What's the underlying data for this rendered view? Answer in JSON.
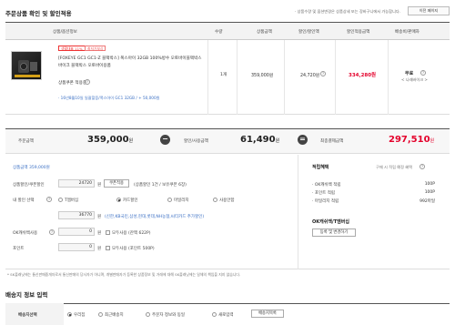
{
  "header": {
    "title": "주문상품 확인 및 할인적용",
    "notice": "· 상품수량 및 옵션변경은 상품상세 또는 장바구니에서 가능합니다.",
    "prev_button": "이전 페이지"
  },
  "table": {
    "columns": [
      "상품/옵션정보",
      "수량",
      "상품금액",
      "할인/할인액",
      "할인적용금액",
      "배송비/판매자"
    ],
    "item": {
      "badges": [
        "생활대표 11%",
        "최저가보상"
      ],
      "name": "[FOXEYE GC1 GC1-Z 블랙박스] 폭스아이 32GB 100%방수 오토바이블랙박스 바이크 블랙박스 오토바이용품",
      "coupon_label": "상품쿠폰 적용중",
      "date_option": "· 16년8월10일 일괄할증/폭스아이 GC1 32GB / + 50,000원",
      "quantity": "1개",
      "price": "359,000원",
      "discount": "24,720원",
      "final_price": "334,280원",
      "shipping": "무료",
      "seller": "< 나래바이크 >"
    }
  },
  "summary": {
    "order_label": "주문금액",
    "order_amount": "359,000",
    "discount_label": "할인/사용금액",
    "discount_amount": "61,490",
    "total_label": "최종결제금액",
    "total_amount": "297,510",
    "won": "원",
    "minus": "−",
    "equals": "="
  },
  "discounts": {
    "product_amount": "상품금액 359,000원",
    "coupon_label": "상품할인/쿠폰할인",
    "coupon_value": "24720",
    "coupon_unit": "원",
    "coupon_button": "쿠폰적용",
    "coupon_info": "(상품할인 1건 / 보유쿠폰 6장)",
    "card_label": "내 할인 선택",
    "card_options": [
      "T멤버십",
      "카드할인",
      "마일리지",
      "사용안함"
    ],
    "card_value": "36770",
    "card_unit": "원",
    "card_info": "(신한,KB국민,삼성,현대,롯데,NH농협,씨티카드 추가할인)",
    "ok_label": "OK캐쉬백사용",
    "ok_value": "0",
    "ok_unit": "원",
    "ok_all": "모두사용 (잔액 622P)",
    "point_label": "포인트",
    "point_value": "0",
    "point_unit": "원",
    "point_all": "모두사용 (포인트 500P)"
  },
  "benefits": {
    "title": "적립혜택",
    "subtitle": "구매 시 적립 예정 혜택",
    "rows": [
      {
        "label": "· OK캐쉬백 적립",
        "value": "100P"
      },
      {
        "label": "· 포인트 적립",
        "value": "100P"
      },
      {
        "label": "· 마일리지 적립",
        "value": "992마일"
      }
    ],
    "ok_title": "OK캐쉬백/T멤버십",
    "ok_button": "등록 및 변경하기"
  },
  "footnote": "* SK플래닛에는 통신판매중개자로서 통신판매의 당사자가 아니며, 개별판매자가 등록한 상품정보 및 거래에 대해 SK플래닛에는 일체의 책임을 지지 않습니다.",
  "shipping": {
    "title": "배송지 정보 입력",
    "label": "배송지선택",
    "options": [
      "우리집",
      "최근배송지",
      "주문자 정보와 동일",
      "새로입력"
    ],
    "button": "배송지목록"
  }
}
